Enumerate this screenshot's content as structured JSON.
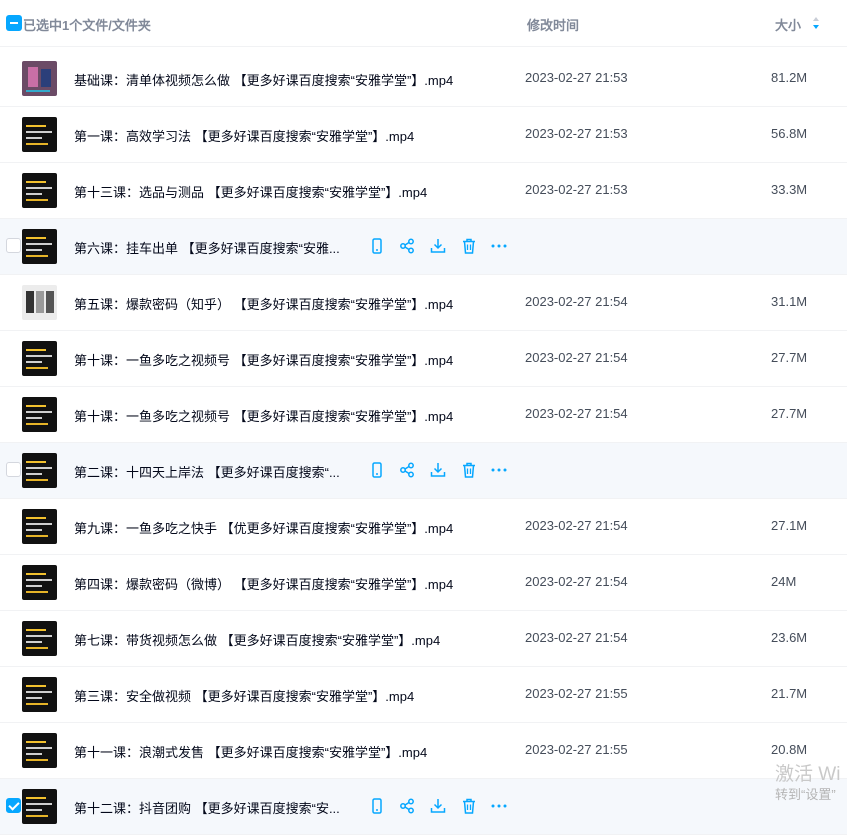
{
  "header": {
    "selected_text": "已选中1个文件/文件夹",
    "col_time": "修改时间",
    "col_size": "大小"
  },
  "rows": [
    {
      "name": "基础课：清单体视频怎么做 【更多好课百度搜索“安雅学堂”】.mp4",
      "date": "2023-02-27 21:53",
      "size": "81.2M",
      "thumb": "video-thumbnail"
    },
    {
      "name": "第一课：高效学习法 【更多好课百度搜索“安雅学堂”】.mp4",
      "date": "2023-02-27 21:53",
      "size": "56.8M",
      "thumb": "video-thumbnail"
    },
    {
      "name": "第十三课：选品与测品 【更多好课百度搜索“安雅学堂”】.mp4",
      "date": "2023-02-27 21:53",
      "size": "33.3M",
      "thumb": "video-thumbnail"
    },
    {
      "name": "第六课：挂车出单 【更多好课百度搜索“安雅...",
      "date": "",
      "size": "",
      "thumb": "video-thumbnail",
      "hover": true
    },
    {
      "name": "第五课：爆款密码（知乎） 【更多好课百度搜索“安雅学堂”】.mp4",
      "date": "2023-02-27 21:54",
      "size": "31.1M",
      "thumb": "video-thumbnail"
    },
    {
      "name": "第十课：一鱼多吃之视频号 【更多好课百度搜索“安雅学堂”】.mp4",
      "date": "2023-02-27 21:54",
      "size": "27.7M",
      "thumb": "video-thumbnail"
    },
    {
      "name": "第十课：一鱼多吃之视频号 【更多好课百度搜索“安雅学堂”】.mp4",
      "date": "2023-02-27 21:54",
      "size": "27.7M",
      "thumb": "video-thumbnail"
    },
    {
      "name": "第二课：十四天上岸法 【更多好课百度搜索“...",
      "date": "",
      "size": "",
      "thumb": "video-thumbnail",
      "hover": true
    },
    {
      "name": "第九课：一鱼多吃之快手 【优更多好课百度搜索“安雅学堂”】.mp4",
      "date": "2023-02-27 21:54",
      "size": "27.1M",
      "thumb": "video-thumbnail"
    },
    {
      "name": "第四课：爆款密码（微博） 【更多好课百度搜索“安雅学堂”】.mp4",
      "date": "2023-02-27 21:54",
      "size": "24M",
      "thumb": "video-thumbnail"
    },
    {
      "name": "第七课：带货视频怎么做 【更多好课百度搜索“安雅学堂”】.mp4",
      "date": "2023-02-27 21:54",
      "size": "23.6M",
      "thumb": "video-thumbnail"
    },
    {
      "name": "第三课：安全做视频 【更多好课百度搜索“安雅学堂”】.mp4",
      "date": "2023-02-27 21:55",
      "size": "21.7M",
      "thumb": "video-thumbnail"
    },
    {
      "name": "第十一课：浪潮式发售 【更多好课百度搜索“安雅学堂”】.mp4",
      "date": "2023-02-27 21:55",
      "size": "20.8M",
      "thumb": "video-thumbnail"
    },
    {
      "name": "第十二课：抖音团购 【更多好课百度搜索“安...",
      "date": "",
      "size": "",
      "thumb": "video-thumbnail",
      "hover": true,
      "selected": true
    }
  ],
  "row_actions": [
    "phone-icon",
    "share-icon",
    "download-icon",
    "delete-icon",
    "more-icon"
  ],
  "watermark": {
    "line1": "激活 Wi",
    "line2": "转到“设置”"
  },
  "colors": {
    "accent": "#06a7ff",
    "hover_row": "#f5f8fc",
    "text_primary": "#03081a",
    "text_secondary": "#454d5a"
  }
}
